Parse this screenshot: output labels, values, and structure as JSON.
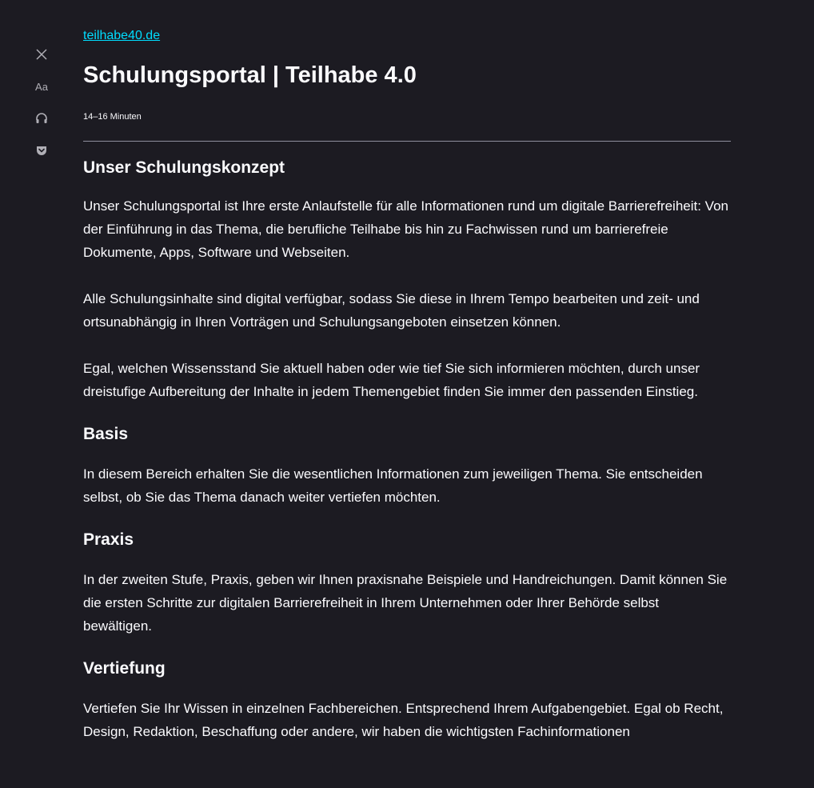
{
  "toolbar": {
    "close": "close-icon",
    "type_controls_label": "Aa",
    "narrate": "headphones-icon",
    "pocket": "pocket-icon"
  },
  "article": {
    "domain": "teilhabe40.de",
    "title": "Schulungsportal | Teilhabe 4.0",
    "reading_time": "14–16 Minuten",
    "sections": [
      {
        "heading": "Unser Schulungskonzept",
        "paragraphs": [
          "Unser Schulungsportal ist Ihre erste Anlaufstelle für alle Informationen rund um digitale Barrierefreiheit: Von der Einführung in das Thema, die berufliche Teilhabe bis hin zu Fachwissen rund um barrierefreie Dokumente, Apps, Software und Webseiten.",
          "Alle Schulungsinhalte sind digital verfügbar, sodass Sie diese in Ihrem Tempo bearbeiten und zeit- und ortsunabhängig in Ihren Vorträgen und Schulungsangeboten einsetzen können.",
          "Egal, welchen Wissensstand Sie aktuell haben oder wie tief Sie sich informieren möchten, durch unser dreistufige Aufbereitung der Inhalte in jedem Themengebiet finden Sie immer den passenden Einstieg."
        ]
      },
      {
        "heading": "Basis",
        "paragraphs": [
          "In diesem Bereich erhalten Sie die wesentlichen Informationen zum jeweiligen Thema. Sie entscheiden selbst, ob Sie das Thema danach weiter vertiefen möchten."
        ]
      },
      {
        "heading": "Praxis",
        "paragraphs": [
          "In der zweiten Stufe, Praxis, geben wir Ihnen praxisnahe Beispiele und Handreichungen. Damit können Sie die ersten Schritte zur digitalen Barrierefreiheit in Ihrem Unternehmen oder Ihrer Behörde selbst bewältigen."
        ]
      },
      {
        "heading": "Vertiefung",
        "paragraphs": [
          "Vertiefen Sie Ihr Wissen in einzelnen Fachbereichen. Entsprechend Ihrem Aufgabengebiet. Egal ob Recht, Design, Redaktion, Beschaffung oder andere, wir haben die wichtigsten Fachinformationen"
        ]
      }
    ]
  }
}
